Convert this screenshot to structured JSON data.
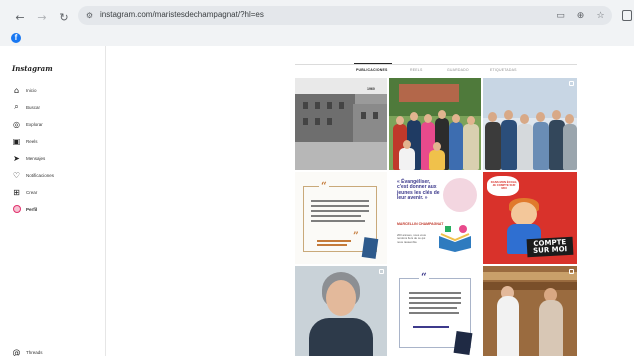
{
  "browser": {
    "url": "instagram.com/maristesdechampagnat/?hl=es",
    "icons": {
      "back": "arrow-left-icon",
      "forward": "arrow-right-icon",
      "reload": "reload-icon",
      "site_info": "tune-icon",
      "cast": "cast-icon",
      "zoom": "zoom-icon",
      "star": "star-icon",
      "extensions": "extensions-icon"
    }
  },
  "bookmarks": {
    "facebook": "f"
  },
  "sidebar": {
    "logo": "Instagram",
    "items": [
      {
        "label": "Inicio",
        "icon": "home-icon",
        "glyph": "⌂"
      },
      {
        "label": "Buscar",
        "icon": "search-icon",
        "glyph": "⌕"
      },
      {
        "label": "Explorar",
        "icon": "compass-icon",
        "glyph": "◎"
      },
      {
        "label": "Reels",
        "icon": "reels-icon",
        "glyph": "▣"
      },
      {
        "label": "Mensajes",
        "icon": "messages-icon",
        "glyph": "➤"
      },
      {
        "label": "Notificaciones",
        "icon": "heart-icon",
        "glyph": "♡"
      },
      {
        "label": "Crear",
        "icon": "create-icon",
        "glyph": "⊞"
      },
      {
        "label": "Perfil",
        "icon": "avatar-icon",
        "glyph": ""
      }
    ],
    "more": {
      "label": "Threads",
      "icon": "threads-icon",
      "glyph": "@"
    }
  },
  "profile": {
    "tabs": [
      {
        "label": "PUBLICACIONES",
        "active": true
      },
      {
        "label": "REELS",
        "active": false
      },
      {
        "label": "GUARDADO",
        "active": false
      },
      {
        "label": "ETIQUETADAS",
        "active": false
      }
    ],
    "posts": [
      {
        "kind": "photo",
        "caption": "1960"
      },
      {
        "kind": "photo",
        "caption": ""
      },
      {
        "kind": "photo",
        "caption": ""
      },
      {
        "kind": "quote",
        "caption": ""
      },
      {
        "kind": "card",
        "headline": "« Évangéliser, c'est donner aux jeunes les clés de leur avenir. »",
        "name": "MARCELLIN CHAMPAGNAT",
        "note": "200 années, nous vous rendons fiers de ce qui nous rassemble"
      },
      {
        "kind": "card",
        "burst": "DANS MON ÉCOLE, JE COMPTE SUR MOI",
        "headline": "COMPTE SUR MOI"
      },
      {
        "kind": "photo",
        "caption": ""
      },
      {
        "kind": "quote",
        "caption": ""
      },
      {
        "kind": "photo",
        "caption": ""
      }
    ]
  },
  "colors": {
    "accent": "#1877f2",
    "instagram_pink": "#e1306c",
    "card_red": "#d9322b",
    "card_purple": "#3d3a8c"
  }
}
